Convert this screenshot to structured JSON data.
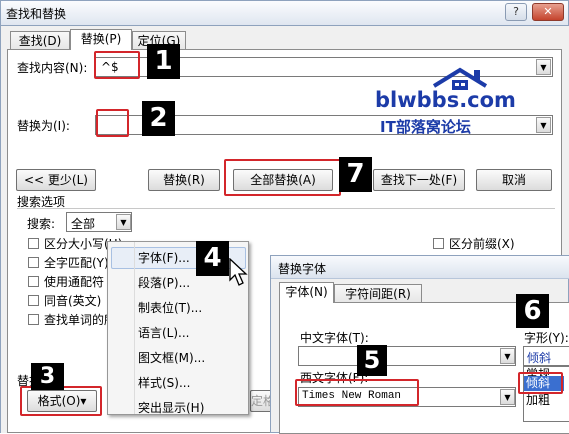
{
  "window": {
    "title": "查找和替换",
    "help_glyph": "?",
    "close_glyph": "✕"
  },
  "tabs": [
    {
      "label": "查找(D)",
      "active": false
    },
    {
      "label": "替换(P)",
      "active": true
    },
    {
      "label": "定位(G)",
      "active": false
    }
  ],
  "find": {
    "label": "查找内容(N):",
    "value": "^$"
  },
  "replace": {
    "label": "替换为(I):",
    "value": ""
  },
  "buttons": {
    "less": "<< 更少(L)",
    "replace": "替换(R)",
    "replace_all": "全部替换(A)",
    "find_next": "查找下一处(F)",
    "cancel": "取消"
  },
  "search_options": {
    "title": "搜索选项",
    "search_label": "搜索:",
    "search_value": "全部",
    "checkboxes": [
      "区分大小写(H)",
      "全字匹配(Y)",
      "使用通配符",
      "同音(英文)",
      "查找单词的所"
    ],
    "right_checkboxes": [
      "区分前缀(X)"
    ]
  },
  "replace_section": {
    "label": "替换",
    "format_button": "格式(O)▾",
    "extra_partial": "定格"
  },
  "format_menu": {
    "items": [
      "字体(F)...",
      "段落(P)...",
      "制表位(T)...",
      "语言(L)...",
      "图文框(M)...",
      "样式(S)...",
      "突出显示(H)"
    ]
  },
  "font_dialog": {
    "title": "替换字体",
    "tabs": [
      "字体(N)",
      "字符间距(R)"
    ],
    "cn_font_label": "中文字体(T):",
    "cn_font_value": "",
    "west_font_label": "西文字体(F):",
    "west_font_value": "Times New Roman",
    "style_label": "字形(Y):",
    "style_value": "倾斜",
    "style_options": [
      "常规",
      "倾斜",
      "加粗"
    ],
    "style_selected": "倾斜"
  },
  "markers": [
    "1",
    "2",
    "3",
    "4",
    "5",
    "6",
    "7"
  ],
  "watermark": {
    "site": "blwbbs.com",
    "caption": "IT部落窝论坛"
  },
  "colors": {
    "annotation_red": "#d3262b",
    "logo_blue": "#1c3ba8",
    "highlight_blue": "#3a6fd0"
  }
}
